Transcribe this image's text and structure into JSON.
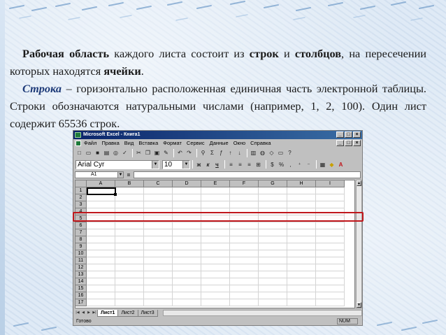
{
  "paragraph1": {
    "bold1": "Рабочая область",
    "t1": " каждого листа состоит из ",
    "bold2": "строк",
    "t2": " и ",
    "bold3": "столбцов",
    "t3": ", на пересечении которых находятся ",
    "bold4": "ячейки",
    "t4": "."
  },
  "paragraph2": {
    "term": "Строка",
    "t1": " – горизонтально расположенная единичная часть электронной таблицы. Строки обозначаются натуральными числами (например, 1, 2, 100). Один лист содержит 65536 строк."
  },
  "excel": {
    "title": "Microsoft Excel - Книга1",
    "menu": [
      "Файл",
      "Правка",
      "Вид",
      "Вставка",
      "Формат",
      "Сервис",
      "Данные",
      "Окно",
      "Справка"
    ],
    "font_name": "Arial Cyr",
    "font_size": "10",
    "name_box": "A1",
    "formula_eq": "=",
    "columns": [
      "A",
      "B",
      "C",
      "D",
      "E",
      "F",
      "G",
      "H",
      "I"
    ],
    "rows": [
      "1",
      "2",
      "3",
      "4",
      "5",
      "6",
      "7",
      "8",
      "9",
      "10",
      "11",
      "12",
      "13",
      "14",
      "15",
      "16",
      "17"
    ],
    "sheet_tabs": [
      "Лист1",
      "Лист2",
      "Лист3"
    ],
    "status": "Готово",
    "status_num": "NUM",
    "highlighted_row": "3"
  },
  "colors": {
    "highlight": "#c0171c",
    "title_bar": "#0a246a",
    "term": "#1d3a78"
  }
}
